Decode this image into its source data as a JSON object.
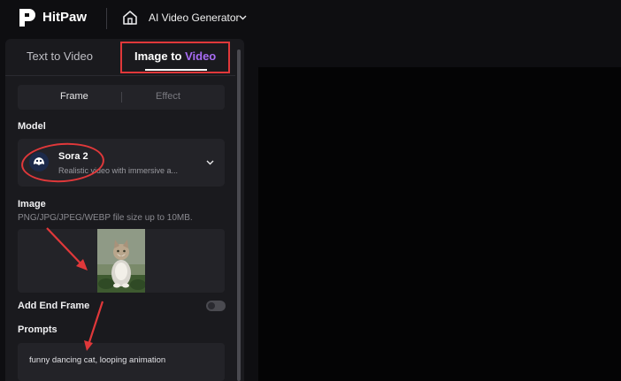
{
  "header": {
    "brand": "HitPaw",
    "module": "AI Video Generator"
  },
  "tabs": {
    "text_to_video": "Text to Video",
    "image_to_video_a": "Image",
    "image_to_video_b": " to ",
    "image_to_video_c": "Video"
  },
  "segments": {
    "frame": "Frame",
    "effect": "Effect"
  },
  "model": {
    "label": "Model",
    "name": "Sora 2",
    "description": "Realistic video with immersive a..."
  },
  "image": {
    "label": "Image",
    "hint": "PNG/JPG/JPEG/WEBP file size up to 10MB."
  },
  "end_frame": {
    "label": "Add End Frame",
    "enabled": false
  },
  "prompts": {
    "label": "Prompts",
    "value": "funny dancing cat, looping animation"
  },
  "colors": {
    "annotation_red": "#e0383a",
    "accent_purple": "#a86cf5",
    "panel_bg": "#1a1a1e"
  }
}
